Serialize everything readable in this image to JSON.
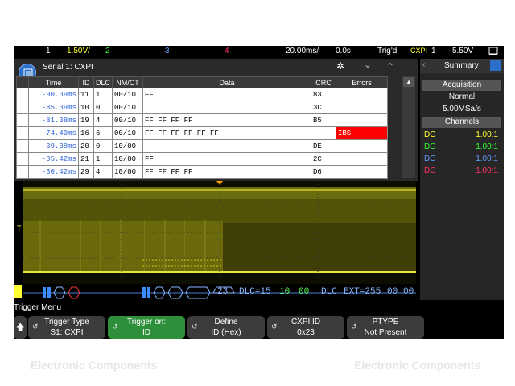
{
  "watermark": {
    "left": "Electronic Components",
    "right": "Electronic Components"
  },
  "topbar": {
    "ch1_num": "1",
    "ch1_scale": "1.50V/",
    "ch2": "2",
    "ch3": "3",
    "ch4": "4",
    "timebase": "20.00ms/",
    "delay": "0.0s",
    "status": "Trig'd",
    "trig_src": "CXPI",
    "trig_ch": "1",
    "trig_level": "5.50V",
    "colors": {
      "ch1": "#ffff33",
      "ch2": "#33ff33",
      "ch3": "#6699ff",
      "ch4": "#ff3366"
    }
  },
  "panel": {
    "title": "Serial 1: CXPI",
    "columns": [
      "Time",
      "ID",
      "DLC",
      "NM/CT",
      "Data",
      "CRC",
      "Errors"
    ],
    "rows": [
      {
        "time": "-90.39ms",
        "id": "11",
        "dlc": "1",
        "nmct": "00/10",
        "data": "FF",
        "crc": "83",
        "errors": ""
      },
      {
        "time": "-85.39ms",
        "id": "10",
        "dlc": "0",
        "nmct": "00/10",
        "data": "",
        "crc": "3C",
        "errors": ""
      },
      {
        "time": "-81.38ms",
        "id": "19",
        "dlc": "4",
        "nmct": "00/10",
        "data": "FF FF FF FF",
        "crc": "B5",
        "errors": ""
      },
      {
        "time": "-74.40ms",
        "id": "16",
        "dlc": "6",
        "nmct": "00/10",
        "data": "FF FF FF FF FF FF",
        "crc": "",
        "errors": "IBS"
      },
      {
        "time": "-39.38ms",
        "id": "20",
        "dlc": "0",
        "nmct": "10/00",
        "data": "",
        "crc": "DE",
        "errors": ""
      },
      {
        "time": "-35.42ms",
        "id": "21",
        "dlc": "1",
        "nmct": "10/00",
        "data": "FF",
        "crc": "2C",
        "errors": ""
      },
      {
        "time": "-30.42ms",
        "id": "29",
        "dlc": "4",
        "nmct": "10/00",
        "data": "FF FF FF FF",
        "crc": "D6",
        "errors": ""
      }
    ]
  },
  "decode": {
    "id": "23",
    "dlc": "DLC=15",
    "nm": "10",
    "ct": "00",
    "dlc2": "DLC",
    "ext": "EXT=255",
    "b1": "00",
    "b2": "00"
  },
  "sidebar": {
    "tab": "Summary",
    "acq_title": "Acquisition",
    "acq_mode": "Normal",
    "acq_rate": "5.00MSa/s",
    "channels_title": "Channels",
    "channels": [
      {
        "name": "DC",
        "ratio": "1.00:1",
        "color": "#ffff33"
      },
      {
        "name": "DC",
        "ratio": "1.00:1",
        "color": "#33ff33"
      },
      {
        "name": "DC",
        "ratio": "1.00:1",
        "color": "#6699ff"
      },
      {
        "name": "DC",
        "ratio": "1.00:1",
        "color": "#ff3366"
      }
    ]
  },
  "trigger_menu": {
    "label": "Trigger Menu",
    "softkeys": [
      {
        "l1": "Trigger Type",
        "l2": "S1: CXPI"
      },
      {
        "l1": "Trigger on:",
        "l2": "ID"
      },
      {
        "l1": "Define",
        "l2": "ID (Hex)"
      },
      {
        "l1": "CXPI ID",
        "l2": "0x23"
      },
      {
        "l1": "PTYPE",
        "l2": "Not Present"
      }
    ]
  }
}
